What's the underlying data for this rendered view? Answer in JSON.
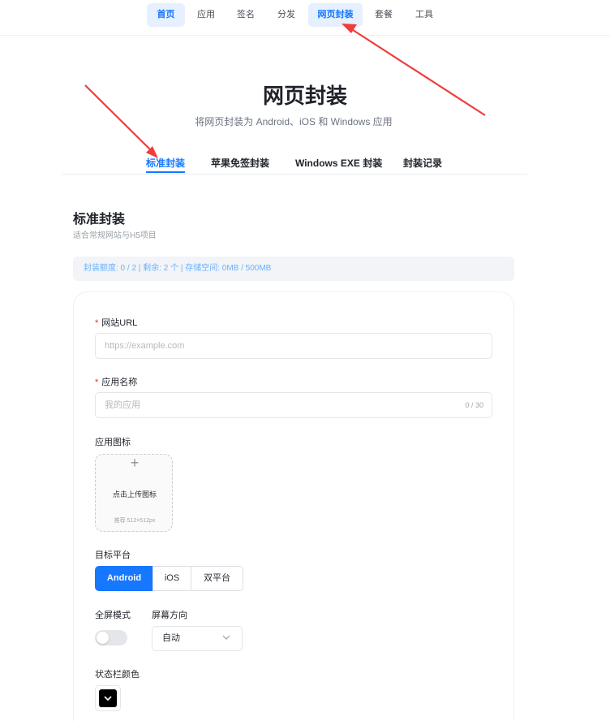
{
  "nav": {
    "items": [
      {
        "label": "首页",
        "active": true
      },
      {
        "label": "应用",
        "active": false
      },
      {
        "label": "签名",
        "active": false
      },
      {
        "label": "分发",
        "active": false
      },
      {
        "label": "网页封装",
        "active": true
      },
      {
        "label": "套餐",
        "active": false
      },
      {
        "label": "工具",
        "active": false
      }
    ]
  },
  "page": {
    "title": "网页封装",
    "subtitle": "将网页封装为 Android、iOS 和 Windows 应用"
  },
  "tabs": [
    {
      "label": "标准封装",
      "active": true
    },
    {
      "label": "苹果免签封装",
      "active": false
    },
    {
      "label": "Windows EXE 封装",
      "active": false
    },
    {
      "label": "封装记录",
      "active": false
    }
  ],
  "section": {
    "title": "标准封装",
    "desc": "适合常规网站与H5项目"
  },
  "quota": {
    "text": "封装额度: 0 / 2 | 剩余: 2 个 | 存储空间: 0MB / 500MB"
  },
  "form": {
    "url": {
      "label": "网站URL",
      "required_mark": "*",
      "placeholder": "https://example.com"
    },
    "name": {
      "label": "应用名称",
      "required_mark": "*",
      "placeholder": "我的应用",
      "counter": "0 / 30"
    },
    "icon": {
      "label": "应用图标",
      "plus": "+",
      "text": "点击上传图标",
      "hint": "推荐 512×512px"
    },
    "platform": {
      "label": "目标平台",
      "options": [
        "Android",
        "iOS",
        "双平台"
      ],
      "selected": "Android"
    },
    "fullscreen": {
      "label": "全屏模式",
      "enabled": false
    },
    "orientation": {
      "label": "屏幕方向",
      "value": "自动"
    },
    "statusbar": {
      "label": "状态栏颜色",
      "color": "#000000"
    }
  },
  "colors": {
    "accent": "#1677ff",
    "annotation_arrow": "#f03c3c"
  }
}
